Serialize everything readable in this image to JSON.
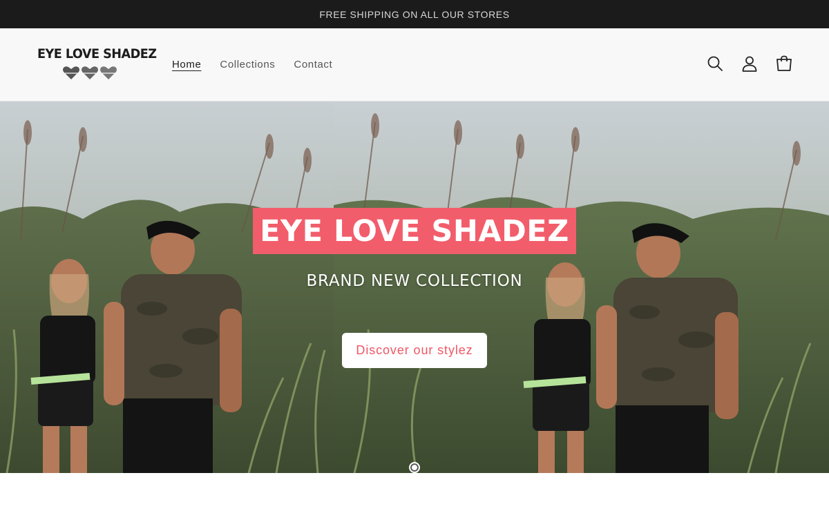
{
  "announcement": {
    "text": "FREE SHIPPING ON ALL OUR STORES"
  },
  "header": {
    "logo_text": "EYE LOVE SHADEZ",
    "nav": [
      {
        "label": "Home",
        "active": true
      },
      {
        "label": "Collections",
        "active": false
      },
      {
        "label": "Contact",
        "active": false
      }
    ],
    "icons": [
      "search-icon",
      "account-icon",
      "cart-icon"
    ]
  },
  "hero": {
    "title": "EYE LOVE SHADEZ",
    "subtitle": "BRAND NEW COLLECTION",
    "button_label": "Discover our stylez",
    "slide_count": 1,
    "current_slide": 1
  },
  "colors": {
    "accent": "#f25d6b",
    "button_text": "#ef5664",
    "announcement_bg": "#1b1b1b",
    "header_bg": "#f8f8f8"
  }
}
